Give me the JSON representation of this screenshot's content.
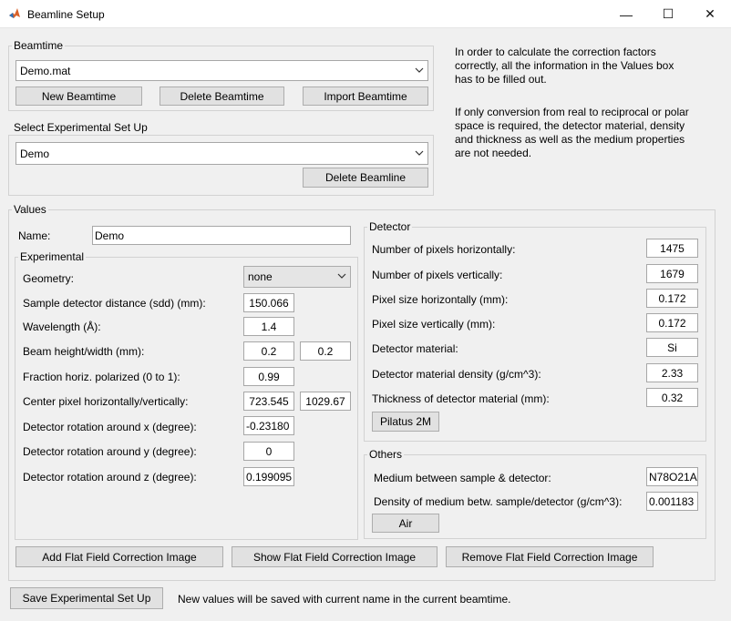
{
  "window": {
    "title": "Beamline Setup",
    "minimize_glyph": "—",
    "maximize_glyph": "☐",
    "close_glyph": "✕"
  },
  "beamtime": {
    "legend": "Beamtime",
    "selected": "Demo.mat",
    "new_label": "New Beamtime",
    "delete_label": "Delete Beamtime",
    "import_label": "Import Beamtime"
  },
  "setup": {
    "legend": "Select Experimental Set Up",
    "selected": "Demo",
    "delete_label": "Delete Beamline"
  },
  "info": {
    "paragraph1": [
      "In order to calculate the correction factors",
      "correctly, all the information in the Values box",
      "has to be filled out."
    ],
    "paragraph2": [
      "If only conversion from real to reciprocal or polar",
      "space is required, the detector material, density",
      "and thickness as well as the medium properties",
      "are not needed."
    ]
  },
  "values": {
    "legend": "Values",
    "name_label": "Name:",
    "name_value": "Demo"
  },
  "experimental": {
    "legend": "Experimental",
    "geometry_label": "Geometry:",
    "geometry_value": "none",
    "sdd_label": "Sample detector distance (sdd) (mm):",
    "sdd_value": "150.066",
    "wavelength_label": "Wavelength (Å):",
    "wavelength_value": "1.4",
    "beam_label": "Beam height/width (mm):",
    "beam_height": "0.2",
    "beam_width": "0.2",
    "fraction_label": "Fraction horiz. polarized (0 to 1):",
    "fraction_value": "0.99",
    "center_label": "Center pixel horizontally/vertically:",
    "center_h": "723.545",
    "center_v": "1029.67",
    "rotx_label": "Detector rotation around x (degree):",
    "rotx_value": "-0.23180",
    "roty_label": "Detector rotation around y (degree):",
    "roty_value": "0",
    "rotz_label": "Detector rotation around z (degree):",
    "rotz_value": "0.199095"
  },
  "detector": {
    "legend": "Detector",
    "px_h_label": "Number of pixels horizontally:",
    "px_h_value": "1475",
    "px_v_label": "Number of pixels vertically:",
    "px_v_value": "1679",
    "size_h_label": "Pixel size horizontally (mm):",
    "size_h_value": "0.172",
    "size_v_label": "Pixel size vertically (mm):",
    "size_v_value": "0.172",
    "material_label": "Detector material:",
    "material_value": "Si",
    "density_label": "Detector material density (g/cm^3):",
    "density_value": "2.33",
    "thickness_label": "Thickness of detector material (mm):",
    "thickness_value": "0.32",
    "preset_label": "Pilatus 2M"
  },
  "others": {
    "legend": "Others",
    "medium_label": "Medium between sample & detector:",
    "medium_value": "N78O21A",
    "medium_density_label": "Density of medium betw. sample/detector (g/cm^3):",
    "medium_density_value": "0.001183",
    "air_label": "Air"
  },
  "flatfield": {
    "add_label": "Add Flat Field Correction Image",
    "show_label": "Show Flat Field Correction Image",
    "remove_label": "Remove Flat Field Correction Image"
  },
  "footer": {
    "save_label": "Save Experimental Set Up",
    "status_text": "New values will be saved with current name in the current beamtime."
  }
}
